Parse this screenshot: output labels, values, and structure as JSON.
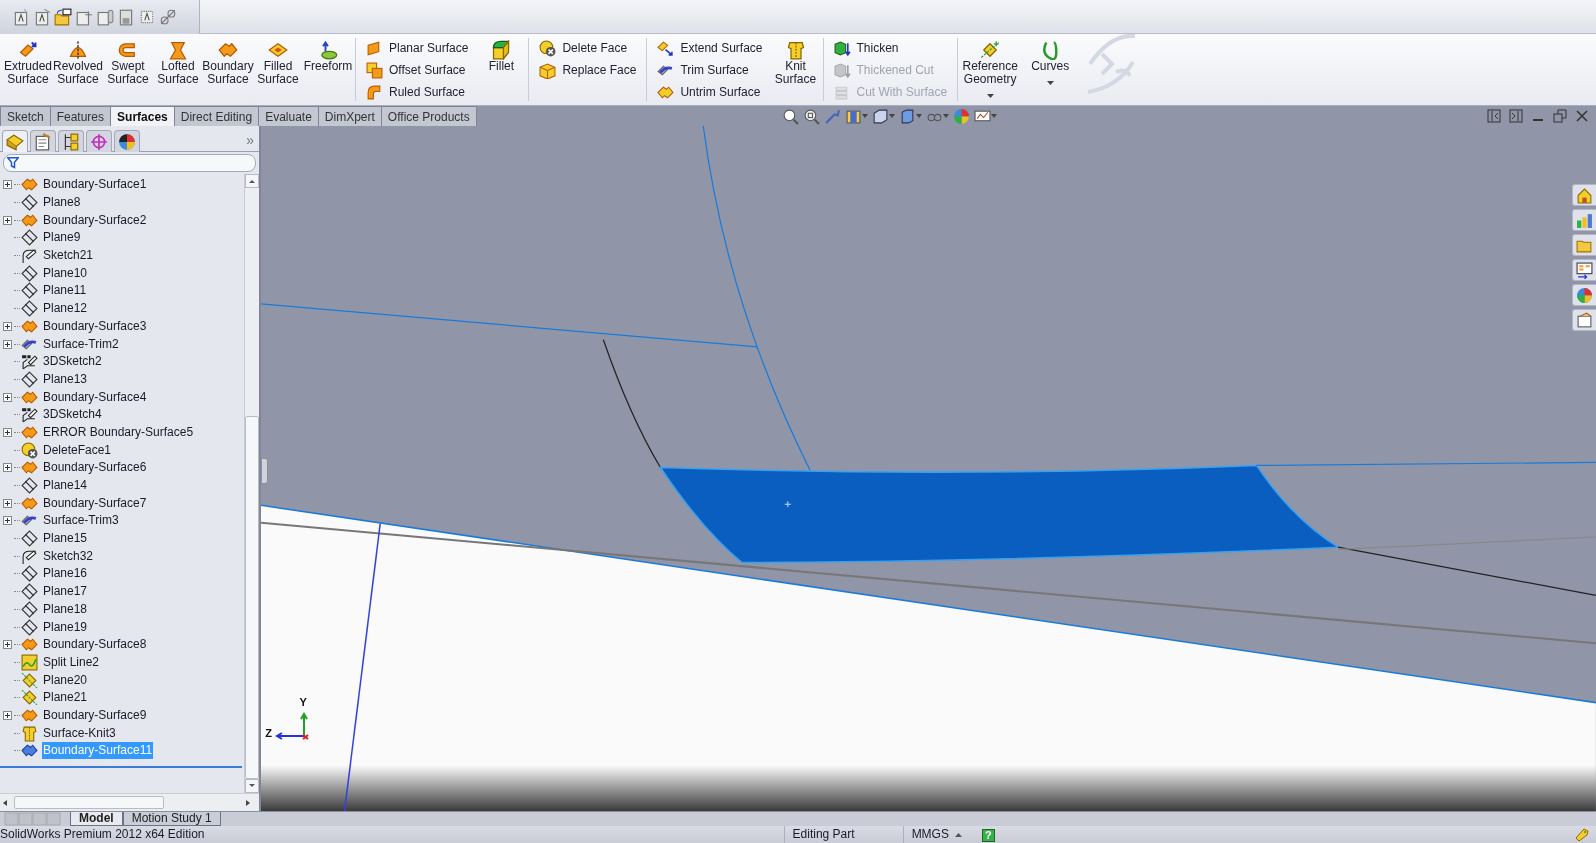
{
  "ribbon": [
    {
      "kind": "large",
      "label": "Extruded Surface",
      "dropdown": false
    },
    {
      "kind": "large",
      "label": "Revolved Surface",
      "dropdown": false
    },
    {
      "kind": "large",
      "label": "Swept Surface",
      "dropdown": false
    },
    {
      "kind": "large",
      "label": "Lofted Surface",
      "dropdown": false
    },
    {
      "kind": "large",
      "label": "Boundary Surface",
      "dropdown": false
    },
    {
      "kind": "large",
      "label": "Filled Surface",
      "dropdown": false
    },
    {
      "kind": "large",
      "label": "Freeform",
      "dropdown": false
    },
    {
      "kind": "stack",
      "items": [
        {
          "label": "Planar Surface",
          "disabled": false
        },
        {
          "label": "Offset Surface",
          "disabled": false
        },
        {
          "label": "Ruled Surface",
          "disabled": false
        }
      ]
    },
    {
      "kind": "large",
      "label": "Fillet",
      "dropdown": false
    },
    {
      "kind": "stack",
      "items": [
        {
          "label": "Delete Face",
          "disabled": false
        },
        {
          "label": "Replace Face",
          "disabled": false
        }
      ]
    },
    {
      "kind": "stack",
      "items": [
        {
          "label": "Extend Surface",
          "disabled": false
        },
        {
          "label": "Trim Surface",
          "disabled": false
        },
        {
          "label": "Untrim Surface",
          "disabled": false
        }
      ]
    },
    {
      "kind": "large",
      "label": "Knit Surface",
      "dropdown": false
    },
    {
      "kind": "stack",
      "items": [
        {
          "label": "Thicken",
          "disabled": false
        },
        {
          "label": "Thickened Cut",
          "disabled": true
        },
        {
          "label": "Cut With Surface",
          "disabled": true
        }
      ]
    },
    {
      "kind": "large",
      "label": "Reference Geometry",
      "dropdown": true
    },
    {
      "kind": "large",
      "label": "Curves",
      "dropdown": true
    }
  ],
  "tabs": [
    {
      "label": "Sketch",
      "selected": false
    },
    {
      "label": "Features",
      "selected": false
    },
    {
      "label": "Surfaces",
      "selected": true
    },
    {
      "label": "Direct Editing",
      "selected": false
    },
    {
      "label": "Evaluate",
      "selected": false
    },
    {
      "label": "DimXpert",
      "selected": false
    },
    {
      "label": "Office Products",
      "selected": false
    }
  ],
  "panel": {
    "tabs": [
      {
        "selected": true
      },
      {
        "selected": false
      },
      {
        "selected": false
      },
      {
        "selected": false
      },
      {
        "selected": false
      }
    ],
    "chevron": "»"
  },
  "tree": [
    {
      "label": "Boundary-Surface1",
      "kind": "boundary",
      "expandable": true,
      "selected": false
    },
    {
      "label": "Plane8",
      "kind": "plane",
      "expandable": false,
      "selected": false
    },
    {
      "label": "Boundary-Surface2",
      "kind": "boundary",
      "expandable": true,
      "selected": false
    },
    {
      "label": "Plane9",
      "kind": "plane",
      "expandable": false,
      "selected": false
    },
    {
      "label": "Sketch21",
      "kind": "sketch",
      "expandable": false,
      "selected": false
    },
    {
      "label": "Plane10",
      "kind": "plane",
      "expandable": false,
      "selected": false
    },
    {
      "label": "Plane11",
      "kind": "plane",
      "expandable": false,
      "selected": false
    },
    {
      "label": "Plane12",
      "kind": "plane",
      "expandable": false,
      "selected": false
    },
    {
      "label": "Boundary-Surface3",
      "kind": "boundary",
      "expandable": true,
      "selected": false
    },
    {
      "label": "Surface-Trim2",
      "kind": "trim",
      "expandable": true,
      "selected": false
    },
    {
      "label": "3DSketch2",
      "kind": "sketch3d",
      "expandable": false,
      "selected": false
    },
    {
      "label": "Plane13",
      "kind": "plane",
      "expandable": false,
      "selected": false
    },
    {
      "label": "Boundary-Surface4",
      "kind": "boundary",
      "expandable": true,
      "selected": false
    },
    {
      "label": "3DSketch4",
      "kind": "sketch3d",
      "expandable": false,
      "selected": false
    },
    {
      "label": "ERROR Boundary-Surface5",
      "kind": "boundary",
      "expandable": true,
      "selected": false
    },
    {
      "label": "DeleteFace1",
      "kind": "deleteface",
      "expandable": false,
      "selected": false
    },
    {
      "label": "Boundary-Surface6",
      "kind": "boundary",
      "expandable": true,
      "selected": false
    },
    {
      "label": "Plane14",
      "kind": "plane",
      "expandable": false,
      "selected": false
    },
    {
      "label": "Boundary-Surface7",
      "kind": "boundary",
      "expandable": true,
      "selected": false
    },
    {
      "label": "Surface-Trim3",
      "kind": "trim",
      "expandable": true,
      "selected": false
    },
    {
      "label": "Plane15",
      "kind": "plane",
      "expandable": false,
      "selected": false
    },
    {
      "label": "Sketch32",
      "kind": "sketch",
      "expandable": false,
      "selected": false
    },
    {
      "label": "Plane16",
      "kind": "plane",
      "expandable": false,
      "selected": false
    },
    {
      "label": "Plane17",
      "kind": "plane",
      "expandable": false,
      "selected": false
    },
    {
      "label": "Plane18",
      "kind": "plane",
      "expandable": false,
      "selected": false
    },
    {
      "label": "Plane19",
      "kind": "plane",
      "expandable": false,
      "selected": false
    },
    {
      "label": "Boundary-Surface8",
      "kind": "boundary",
      "expandable": true,
      "selected": false
    },
    {
      "label": "Split Line2",
      "kind": "splitline",
      "expandable": false,
      "selected": false
    },
    {
      "label": "Plane20",
      "kind": "refplane",
      "expandable": false,
      "selected": false
    },
    {
      "label": "Plane21",
      "kind": "refplane",
      "expandable": false,
      "selected": false
    },
    {
      "label": "Boundary-Surface9",
      "kind": "boundary",
      "expandable": true,
      "selected": false
    },
    {
      "label": "Surface-Knit3",
      "kind": "knit",
      "expandable": false,
      "selected": false
    },
    {
      "label": "Boundary-Surface11",
      "kind": "boundary",
      "expandable": false,
      "selected": true
    }
  ],
  "triad": {
    "y": "Y",
    "z": "Z"
  },
  "bottom_tabs": [
    {
      "label": "Model",
      "selected": true
    },
    {
      "label": "Motion Study 1",
      "selected": false
    }
  ],
  "status_bar": {
    "product": "SolidWorks Premium 2012 x64 Edition",
    "mode": "Editing Part",
    "units": "MMGS",
    "help": "?"
  }
}
